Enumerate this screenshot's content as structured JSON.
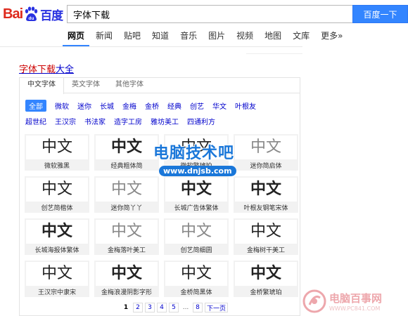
{
  "header": {
    "logo_brand_text": "Bai",
    "logo_du_text": "du",
    "logo_cn_text": "百度",
    "search_value": "字体下载",
    "search_button": "百度一下"
  },
  "nav": {
    "tabs": [
      "网页",
      "新闻",
      "贴吧",
      "知道",
      "音乐",
      "图片",
      "视频",
      "地图",
      "文库",
      "更多»"
    ]
  },
  "result": {
    "title_prefix": "字体下载",
    "title_suffix": "大全"
  },
  "font_panel": {
    "sub_tabs": [
      "中文字体",
      "英文字体",
      "其他字体"
    ],
    "categories_row1": [
      "全部",
      "微软",
      "迷你",
      "长城",
      "金梅",
      "金桥",
      "经典",
      "创艺",
      "华文",
      "叶根友"
    ],
    "categories_row2": [
      "超世纪",
      "王汉宗",
      "书法家",
      "造字工房",
      "雅坊美工",
      "四通利方"
    ],
    "preview_text": "中文",
    "fonts": [
      "微软雅黑",
      "经典粗体简",
      "微软繁琥珀",
      "迷你简启体",
      "创艺简楷体",
      "迷你简丫丫",
      "长城广告体繁体",
      "叶根友钢笔宋体",
      "长城海报体繁体",
      "金梅落叶美工",
      "创艺简细圆",
      "金梅树干美工",
      "王汉宗中隶宋",
      "金梅浪漫阴影字形",
      "金桥简黑体",
      "金桥繁琥珀"
    ],
    "pagination": [
      "1",
      "2",
      "3",
      "4",
      "5",
      "...",
      "8",
      "下一页"
    ]
  },
  "watermark": {
    "title": "电脑技术吧",
    "url": "www.dnjsb.com"
  },
  "watermark2": {
    "name": "电脑百事网",
    "url": "WWW.PC841.COM"
  }
}
